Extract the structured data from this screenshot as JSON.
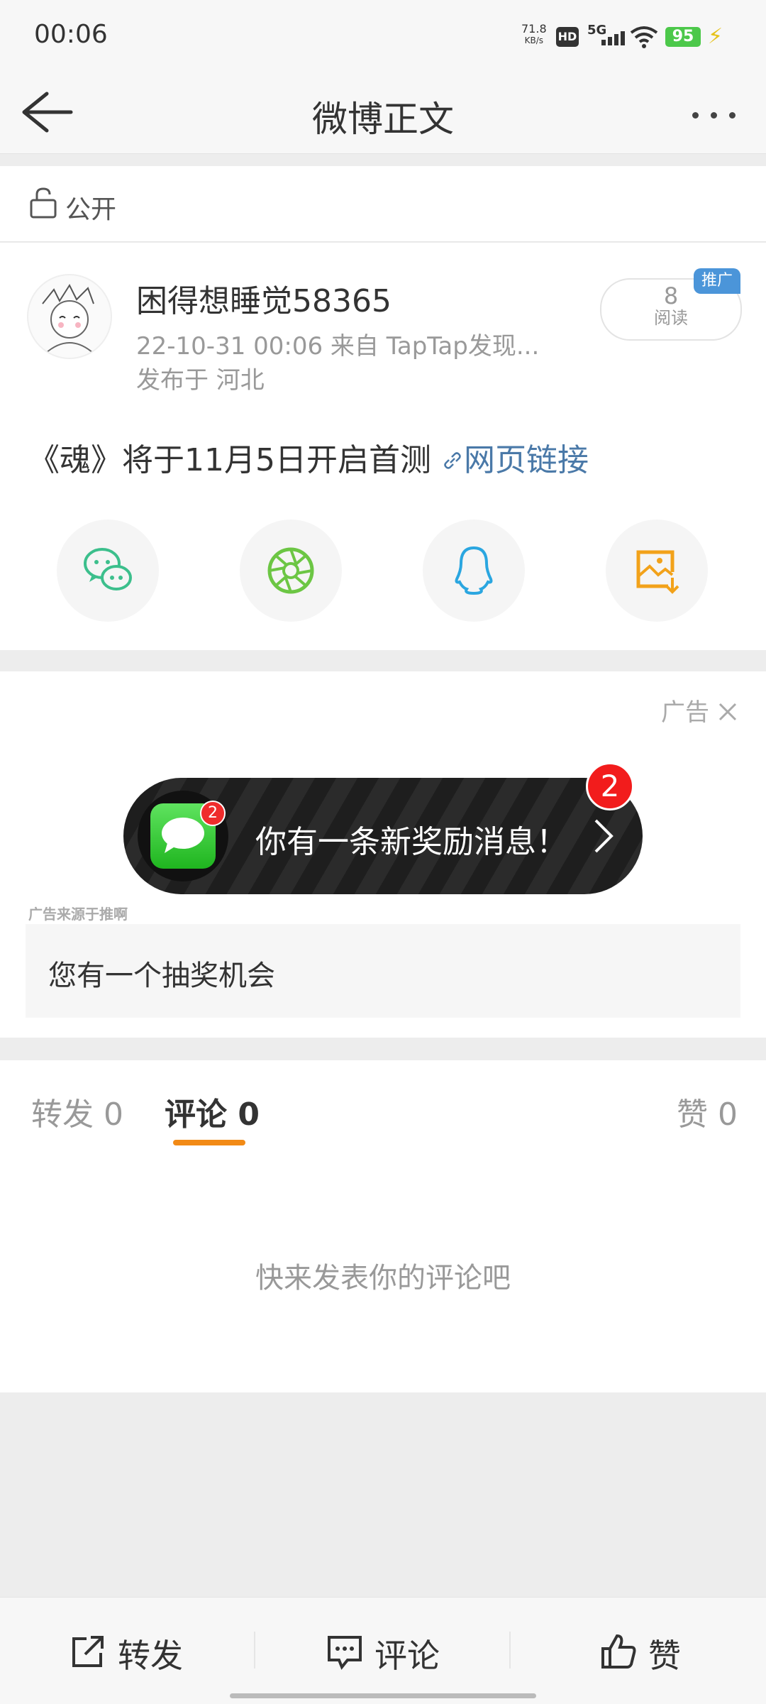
{
  "status": {
    "time": "00:06",
    "speed": "71.8",
    "speed_unit": "KB/s",
    "hd": "HD",
    "network": "5G",
    "battery": "95"
  },
  "header": {
    "title": "微博正文"
  },
  "privacy": {
    "label": "公开"
  },
  "post": {
    "username": "困得想睡觉58365",
    "meta": "22-10-31 00:06   来自 TapTap发现...",
    "location": "发布于 河北",
    "read_count": "8",
    "read_label": "阅读",
    "promo_badge": "推广",
    "text": "《魂》将于11月5日开启首测 ",
    "link_text": "网页链接"
  },
  "share_icons": [
    "wechat-icon",
    "moments-icon",
    "qq-icon",
    "save-image-icon"
  ],
  "ad": {
    "label": "广告",
    "banner_text": "你有一条新奖励消息！",
    "badge_count": "2",
    "icon_badge": "2",
    "source": "广告来源于推啊",
    "chance_text": "您有一个抽奖机会"
  },
  "tabs": {
    "repost": "转发 0",
    "comment": "评论 0",
    "like": "赞 0"
  },
  "comments": {
    "empty_text": "快来发表你的评论吧"
  },
  "bottom_bar": {
    "repost": "转发",
    "comment": "评论",
    "like": "赞"
  },
  "colors": {
    "accent": "#f28a16",
    "link": "#4a79a8",
    "promo": "#4b95d9",
    "wechat": "#3cbf8c",
    "qq": "#2aa6e0",
    "save": "#f2a21a"
  }
}
